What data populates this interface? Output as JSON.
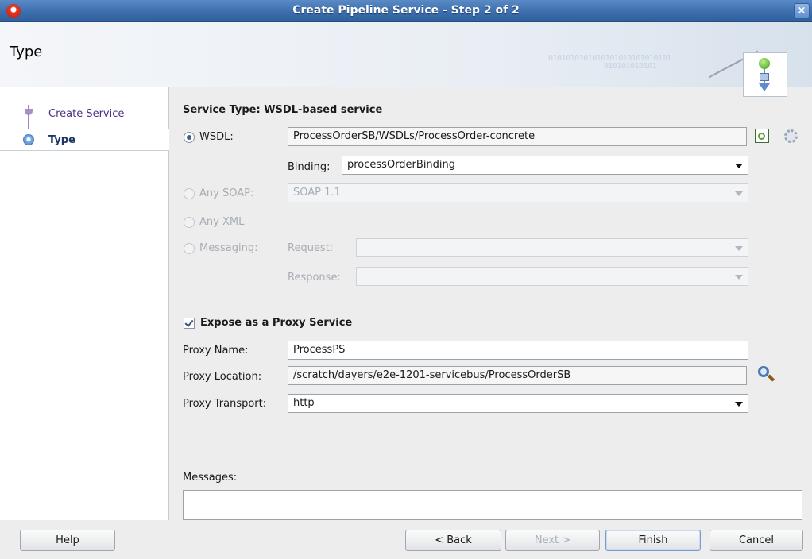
{
  "window": {
    "title": "Create Pipeline Service - Step 2 of 2",
    "close_glyph": "×"
  },
  "header": {
    "title": "Type",
    "binary_text_1": "0101010101010101010101010101",
    "binary_text_2": "010101010101"
  },
  "nav": {
    "items": [
      {
        "label": "Create Service",
        "state": "visited"
      },
      {
        "label": "Type",
        "state": "current"
      }
    ]
  },
  "form": {
    "section_title": "Service Type: WSDL-based service",
    "wsdl": {
      "label": "WSDL:",
      "value": "ProcessOrderSB/WSDLs/ProcessOrder-concrete",
      "selected": true
    },
    "binding": {
      "label": "Binding:",
      "value": "processOrderBinding"
    },
    "any_soap": {
      "label": "Any SOAP:",
      "value": "SOAP 1.1"
    },
    "any_xml": {
      "label": "Any XML"
    },
    "messaging": {
      "label": "Messaging:",
      "request_label": "Request:",
      "response_label": "Response:"
    },
    "expose_proxy": {
      "label": "Expose as a Proxy Service",
      "checked": true
    },
    "proxy_name": {
      "label": "Proxy Name:",
      "value": "ProcessPS"
    },
    "proxy_location": {
      "label": "Proxy Location:",
      "value": "/scratch/dayers/e2e-1201-servicebus/ProcessOrderSB"
    },
    "proxy_transport": {
      "label": "Proxy Transport:",
      "value": "http"
    },
    "messages_label": "Messages:"
  },
  "buttons": {
    "help": "Help",
    "back": "< Back",
    "next": "Next >",
    "finish": "Finish",
    "cancel": "Cancel"
  },
  "icons": {
    "app": "oracle-icon",
    "header": "pipeline-service-icon",
    "wsdl_browse": "wsdl-browse-icon",
    "settings": "gear-icon",
    "location_search": "search-icon"
  },
  "colors": {
    "titlebar": "#3d6fae",
    "nav_link": "#4b2f84",
    "nav_current": "#1b3567"
  }
}
